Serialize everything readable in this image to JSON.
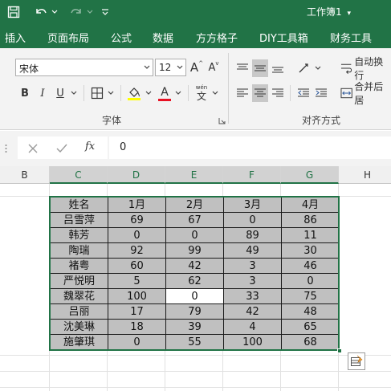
{
  "titlebar": {
    "title": "工作簿1",
    "title_caret": "▾",
    "qat_more": "▾"
  },
  "ribbon_tabs": [
    "插入",
    "页面布局",
    "公式",
    "数据",
    "方方格子",
    "DIY工具箱",
    "财务工具"
  ],
  "font_group": {
    "font_name": "宋体",
    "font_size": "12",
    "grow_label": "A",
    "shrink_label": "A",
    "bold": "B",
    "italic": "I",
    "underline": "U",
    "font_color_label": "A",
    "wen_label": "wén",
    "wen_char": "文",
    "label": "字体"
  },
  "align_group": {
    "wrap_text": "自动换行",
    "merge_center": "合并后居",
    "label": "对齐方式"
  },
  "formula_bar": {
    "fx_label": "fx",
    "value": "0"
  },
  "columns": [
    "B",
    "C",
    "D",
    "E",
    "F",
    "G",
    "H"
  ],
  "table": {
    "header": [
      "姓名",
      "1月",
      "2月",
      "3月",
      "4月"
    ],
    "rows": [
      [
        "吕雪萍",
        "69",
        "67",
        "0",
        "86"
      ],
      [
        "韩芳",
        "0",
        "0",
        "89",
        "11"
      ],
      [
        "陶瑞",
        "92",
        "99",
        "49",
        "30"
      ],
      [
        "褚粤",
        "60",
        "42",
        "3",
        "46"
      ],
      [
        "严悦明",
        "5",
        "62",
        "3",
        "0"
      ],
      [
        "魏翠花",
        "100",
        "0",
        "33",
        "75"
      ],
      [
        "吕丽",
        "17",
        "79",
        "42",
        "48"
      ],
      [
        "沈美琳",
        "18",
        "39",
        "4",
        "65"
      ],
      [
        "施肇琪",
        "0",
        "55",
        "100",
        "68"
      ]
    ]
  },
  "colors": {
    "accent": "#217346",
    "cell_fill": "#c0c0c0",
    "font_color_bar": "#e81123",
    "highlight_bar": "#ffff00"
  }
}
